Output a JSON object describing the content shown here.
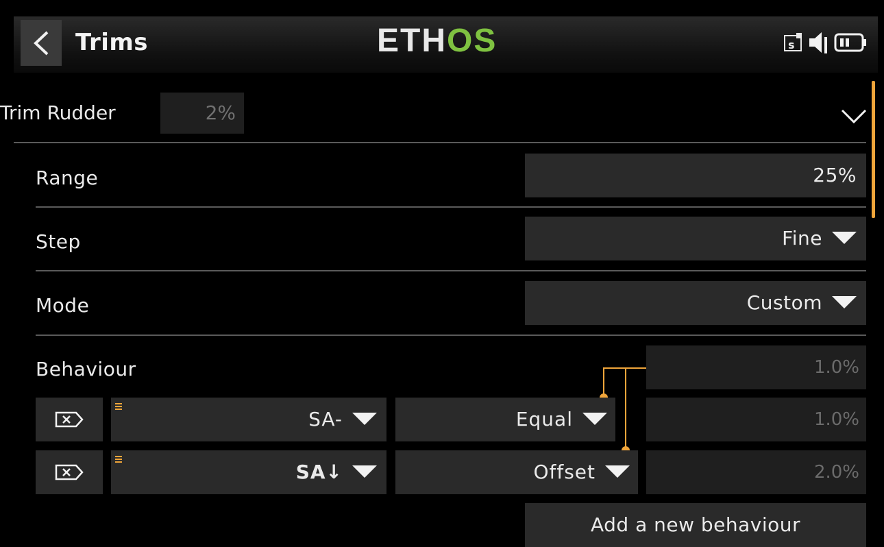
{
  "header": {
    "title": "Trims",
    "logo_primary": "ETH",
    "logo_accent": "OS",
    "status_icons": [
      "switch-indicator-icon",
      "speaker-icon",
      "battery-icon"
    ]
  },
  "trim": {
    "label": "Trim Rudder",
    "value": "2%"
  },
  "settings": {
    "range_label": "Range",
    "range_value": "25%",
    "step_label": "Step",
    "step_value": "Fine",
    "mode_label": "Mode",
    "mode_value": "Custom"
  },
  "behaviour": {
    "label": "Behaviour",
    "base_value": "1.0%",
    "rows": [
      {
        "switch": "SA-",
        "function": "Equal",
        "value": "1.0%"
      },
      {
        "switch": "SA↓",
        "function": "Offset",
        "value": "2.0%"
      }
    ],
    "add_label": "Add a new behaviour"
  },
  "colors": {
    "accent": "#f0a53a",
    "logo_green": "#7fc241",
    "field_bg": "#2a2a2a",
    "dim_bg": "#1f1f1f"
  }
}
